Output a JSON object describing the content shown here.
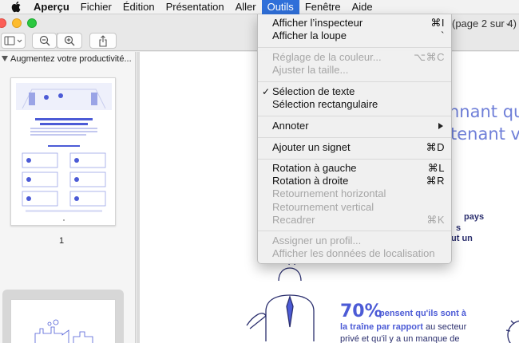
{
  "menubar": {
    "app": "Aperçu",
    "items": [
      "Fichier",
      "Édition",
      "Présentation",
      "Aller",
      "Outils",
      "Fenêtre",
      "Aide"
    ],
    "active": "Outils"
  },
  "window": {
    "doc_title": "(page 2 sur 4)",
    "doc_title_arrow": "⌄"
  },
  "sidebar": {
    "header": "Augmentez votre productivité...",
    "page_label": "1"
  },
  "menu": {
    "items": [
      {
        "label": "Afficher l’inspecteur",
        "shortcut": "⌘I",
        "enabled": true
      },
      {
        "label": "Afficher la loupe",
        "shortcut": "`",
        "enabled": true
      },
      {
        "label": "Réglage de la couleur...",
        "shortcut": "⌥⌘C",
        "enabled": false
      },
      {
        "label": "Ajuster la taille...",
        "shortcut": "",
        "enabled": false
      },
      {
        "label": "Sélection de texte",
        "shortcut": "",
        "enabled": true,
        "checked": true,
        "check": "✓"
      },
      {
        "label": "Sélection rectangulaire",
        "shortcut": "",
        "enabled": true
      },
      {
        "label": "Annoter",
        "shortcut": "",
        "enabled": true,
        "submenu": true
      },
      {
        "label": "Ajouter un signet",
        "shortcut": "⌘D",
        "enabled": true
      },
      {
        "label": "Rotation à gauche",
        "shortcut": "⌘L",
        "enabled": true
      },
      {
        "label": "Rotation à droite",
        "shortcut": "⌘R",
        "enabled": true
      },
      {
        "label": "Retournement horizontal",
        "shortcut": "",
        "enabled": false
      },
      {
        "label": "Retournement vertical",
        "shortcut": "",
        "enabled": false
      },
      {
        "label": "Recadrer",
        "shortcut": "⌘K",
        "enabled": false
      },
      {
        "label": "Assigner un profil...",
        "shortcut": "",
        "enabled": false
      },
      {
        "label": "Afficher les données de localisation",
        "shortcut": "",
        "enabled": false
      }
    ]
  },
  "document": {
    "heading_1": "nnant qu",
    "heading_2": "tenant vo",
    "side_1": "pays",
    "side_2": "s",
    "side_3": "ut un",
    "stat_value": "70%",
    "stat_l1_bold": "pensent qu'ils sont à",
    "stat_l2_bold": "la traîne par rapport",
    "stat_l2_rest": " au secteur",
    "stat_l3": "privé et qu'il y a un manque de"
  },
  "colors": {
    "accent": "#2f6fd9",
    "doc_blue": "#4c5bd6",
    "disabled_text": "#a6a6a6"
  },
  "icons": {
    "apple": "apple-icon",
    "sidebar_toggle": "sidebar-toggle-icon",
    "zoom_out": "zoom-out-icon",
    "zoom_in": "zoom-in-icon",
    "share": "share-icon",
    "submenu": "chevron-right-icon"
  }
}
